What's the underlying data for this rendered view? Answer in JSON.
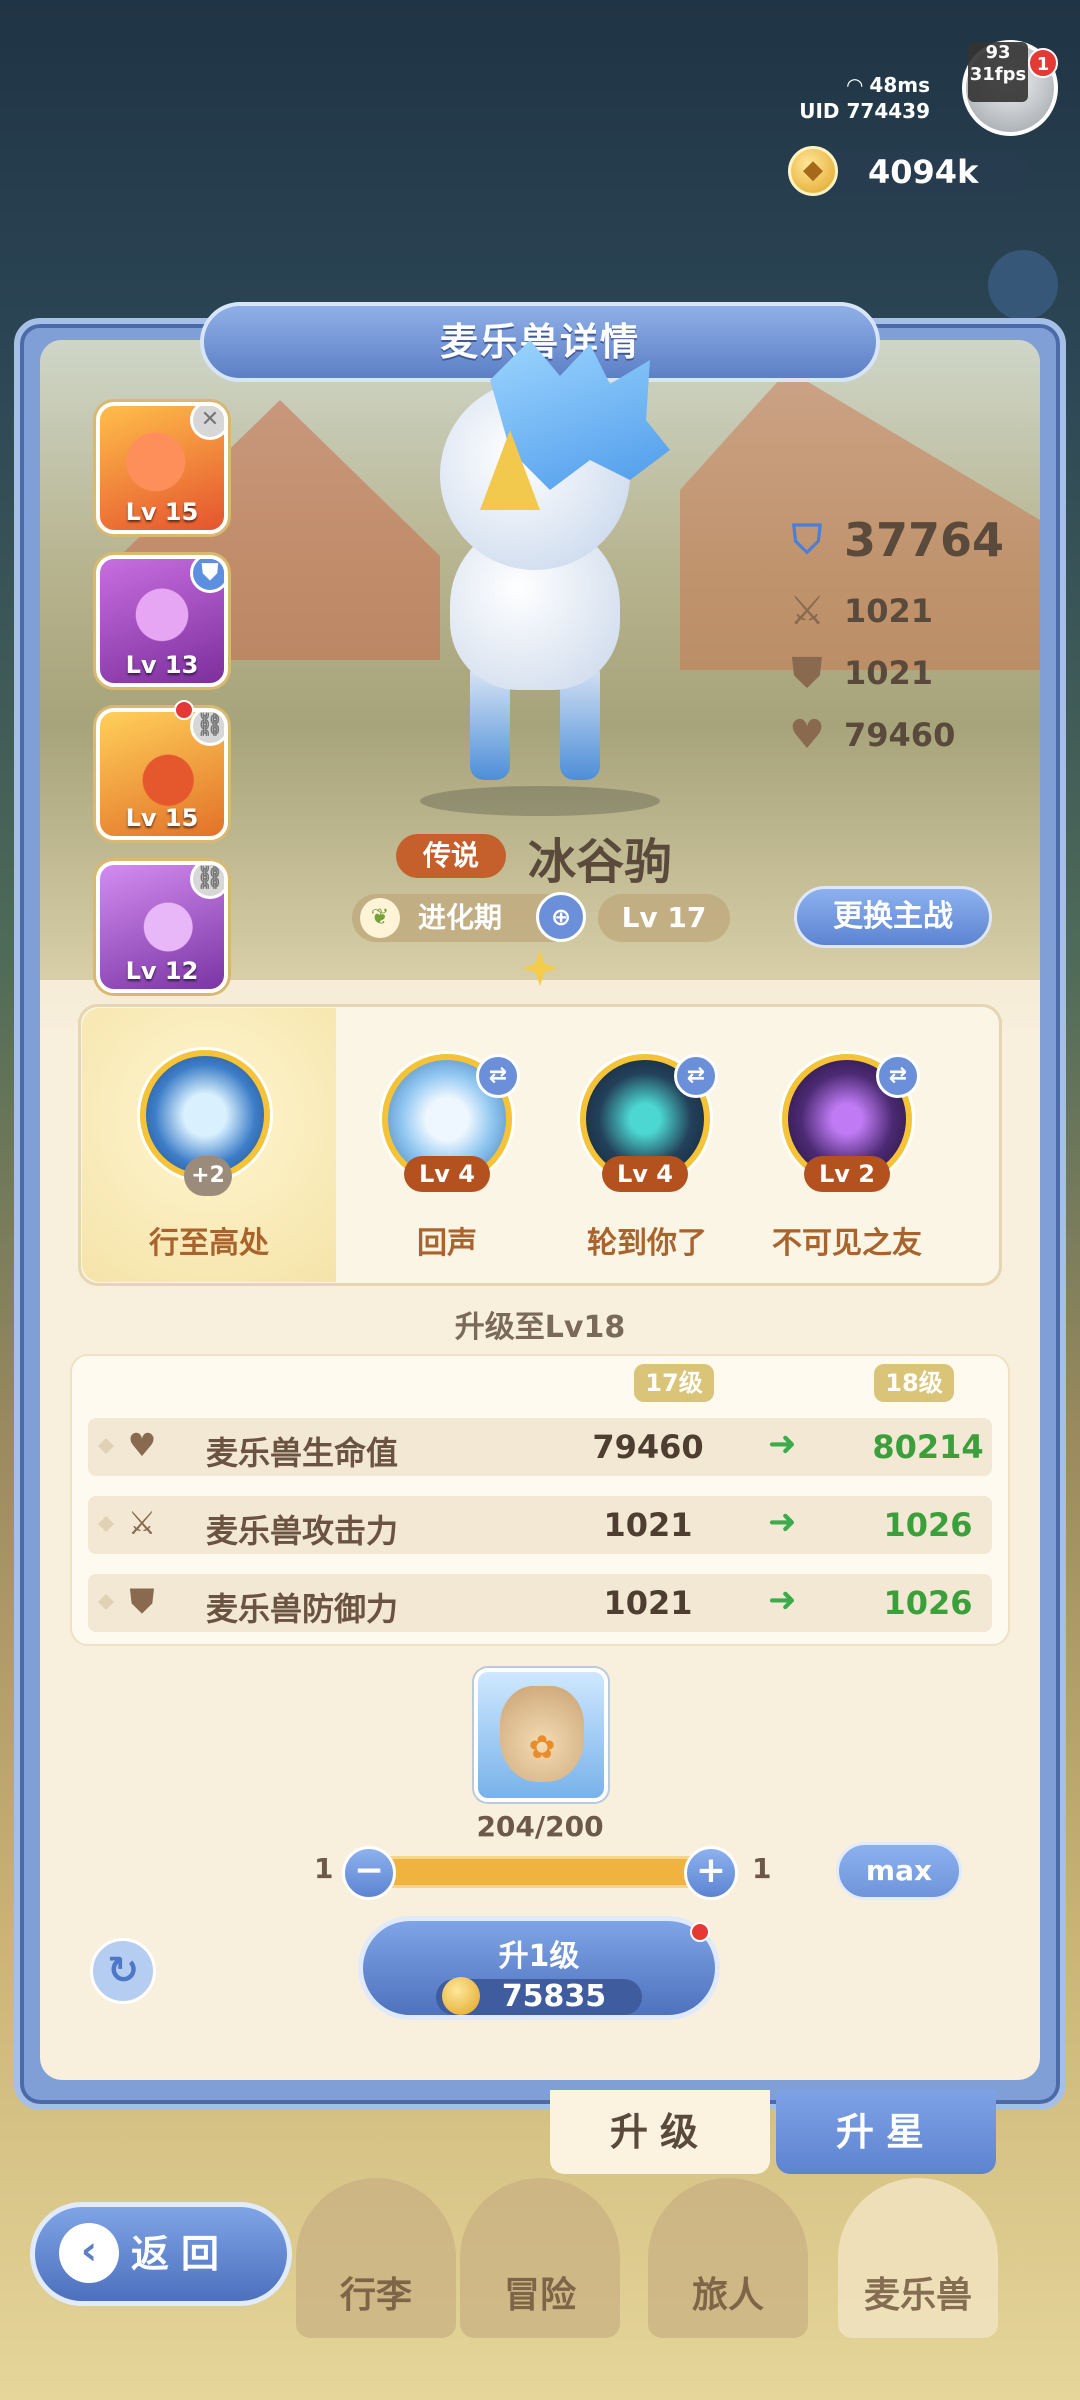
{
  "hud": {
    "ping": "48ms",
    "uid": "UID 774439",
    "fps": "31fps",
    "fps_top": "93",
    "notify_count": "1",
    "coins": "4094k"
  },
  "panel": {
    "title": "麦乐兽详情"
  },
  "pets": [
    {
      "level": "Lv 15",
      "corner": "✕"
    },
    {
      "level": "Lv 13",
      "corner": "⛊"
    },
    {
      "level": "Lv 15",
      "corner": "⛓"
    },
    {
      "level": "Lv 12",
      "corner": "⛓"
    }
  ],
  "stats": {
    "power": "37764",
    "attack": "1021",
    "defense": "1021",
    "hp": "79460"
  },
  "monster": {
    "rarity": "传说",
    "name": "冰谷驹",
    "stage": "进化期",
    "level": "Lv  17",
    "swap_label": "更换主战"
  },
  "skills": [
    {
      "name": "行至高处",
      "badge": "+2"
    },
    {
      "name": "回声",
      "level": "Lv 4"
    },
    {
      "name": "轮到你了",
      "level": "Lv 4"
    },
    {
      "name": "不可见之友",
      "level": "Lv 2"
    }
  ],
  "upgrade": {
    "title": "升级至Lv18",
    "col_current": "17级",
    "col_next": "18级",
    "rows": [
      {
        "label": "麦乐兽生命值",
        "current": "79460",
        "next": "80214"
      },
      {
        "label": "麦乐兽攻击力",
        "current": "1021",
        "next": "1026"
      },
      {
        "label": "麦乐兽防御力",
        "current": "1021",
        "next": "1026"
      }
    ]
  },
  "item": {
    "count": "204/200"
  },
  "slider": {
    "min_label": "1",
    "max_label": "1",
    "minus": "−",
    "plus": "+",
    "max_btn": "max"
  },
  "level_up": {
    "label": "升1级",
    "cost": "75835"
  },
  "tabs": {
    "upgrade": "升级",
    "star": "升星"
  },
  "nav": {
    "back": "返回",
    "bag": "行李",
    "adventure": "冒险",
    "traveler": "旅人",
    "pet": "麦乐兽"
  },
  "colors": {
    "accent": "#5d84d2",
    "rarity": "#c55f2b",
    "increase": "#3b9f3c",
    "gold": "#f0b340"
  }
}
